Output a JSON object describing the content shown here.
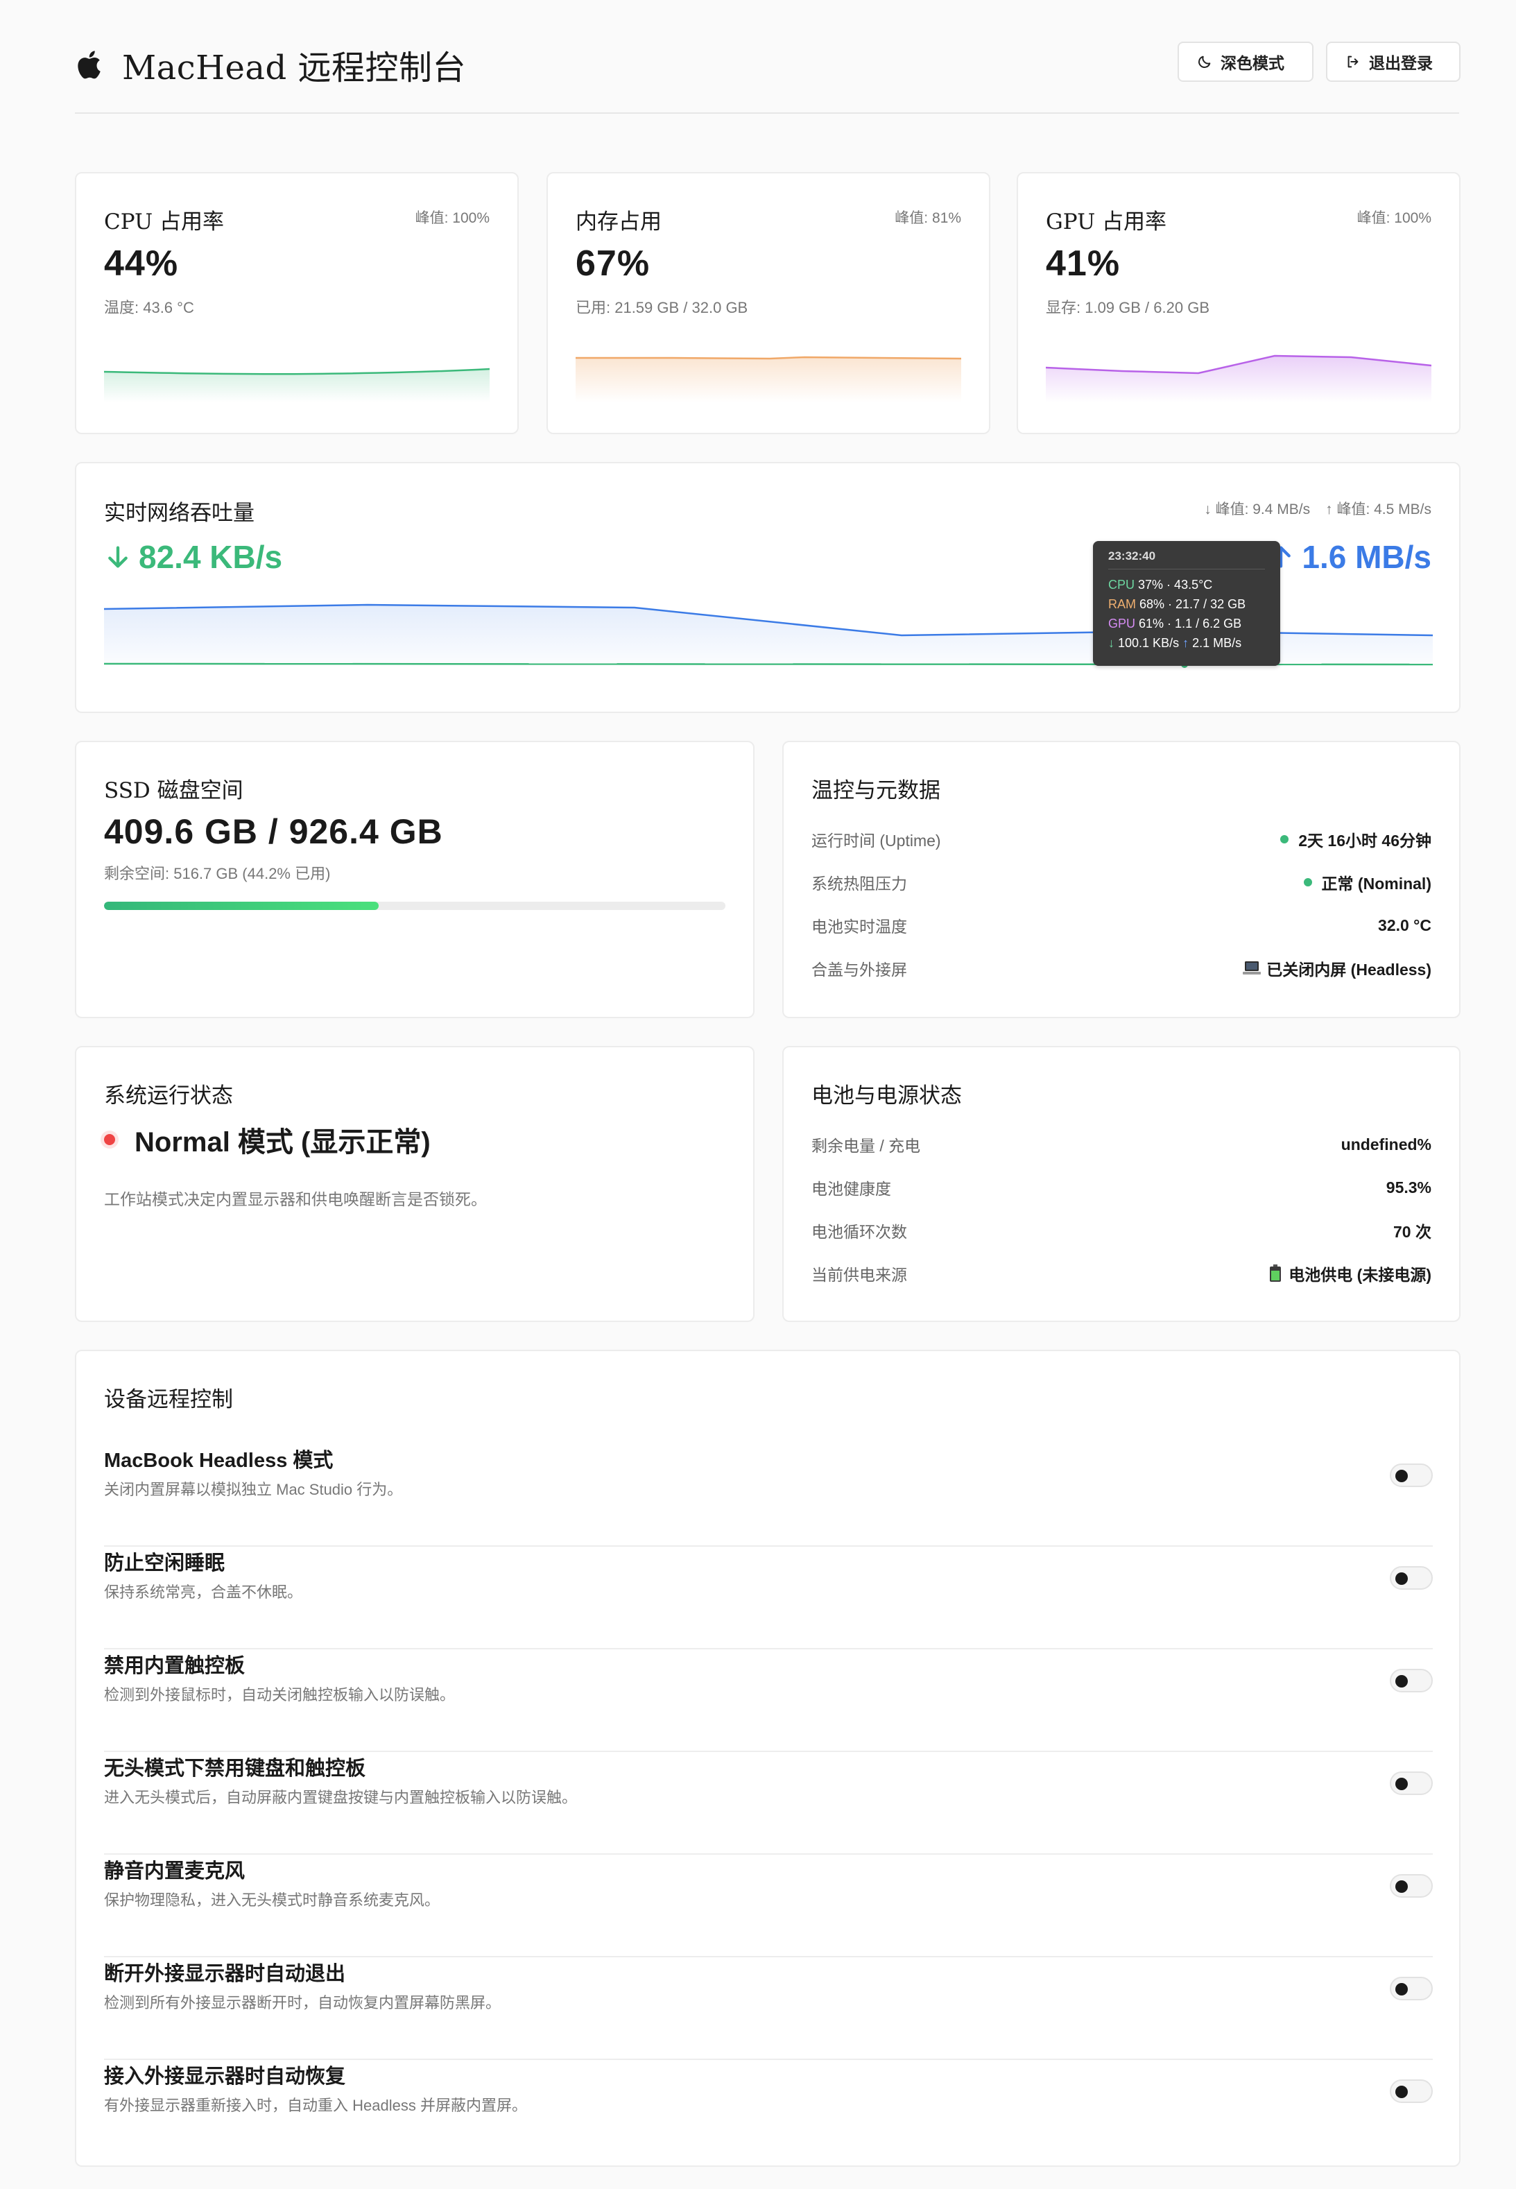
{
  "header": {
    "title": "MacHead 远程控制台",
    "dark_mode_label": "深色模式",
    "logout_label": "退出登录"
  },
  "metrics": {
    "cpu": {
      "title": "CPU 占用率",
      "peak": "峰值: 100%",
      "value": "44%",
      "sub": "温度: 43.6 °C",
      "color": "#3bb97a"
    },
    "mem": {
      "title": "内存占用",
      "peak": "峰值: 81%",
      "value": "67%",
      "sub": "已用: 21.59 GB / 32.0 GB",
      "color": "#f0a868"
    },
    "gpu": {
      "title": "GPU 占用率",
      "peak": "峰值: 100%",
      "value": "41%",
      "sub": "显存: 1.09 GB / 6.20 GB",
      "color": "#b862e8"
    }
  },
  "network": {
    "title": "实时网络吞吐量",
    "peak_down": "↓ 峰值: 9.4 MB/s",
    "peak_up": "↑ 峰值: 4.5 MB/s",
    "down": "82.4 KB/s",
    "up": "1.6 MB/s",
    "down_color": "#3bb97a",
    "up_color": "#3b7be6",
    "tooltip": {
      "time": "23:32:40",
      "cpu_key": "CPU",
      "cpu_val": "37% · 43.5°C",
      "ram_key": "RAM",
      "ram_val": "68% · 21.7 / 32 GB",
      "gpu_key": "GPU",
      "gpu_val": "61% · 1.1 / 6.2 GB",
      "down_val": "100.1 KB/s",
      "up_val": "2.1 MB/s"
    }
  },
  "ssd": {
    "title": "SSD 磁盘空间",
    "value": "409.6 GB / 926.4 GB",
    "sub": "剩余空间: 516.7 GB (44.2% 已用)",
    "used_fraction": 0.442
  },
  "thermal": {
    "title": "温控与元数据",
    "rows": [
      {
        "label": "运行时间 (Uptime)",
        "value": "2天 16小时 46分钟"
      },
      {
        "label": "系统热阻压力",
        "value": "正常 (Nominal)"
      },
      {
        "label": "电池实时温度",
        "value": "32.0 °C"
      },
      {
        "label": "合盖与外接屏",
        "value": "已关闭内屏 (Headless)"
      }
    ]
  },
  "status": {
    "title": "系统运行状态",
    "mode": "Normal 模式 (显示正常)",
    "desc": "工作站模式决定内置显示器和供电唤醒断言是否锁死。"
  },
  "battery": {
    "title": "电池与电源状态",
    "rows": [
      {
        "label": "剩余电量 / 充电",
        "value": "undefined%"
      },
      {
        "label": "电池健康度",
        "value": "95.3%"
      },
      {
        "label": "电池循环次数",
        "value": "70 次"
      },
      {
        "label": "当前供电来源",
        "value": "电池供电 (未接电源)"
      }
    ]
  },
  "controls": {
    "title": "设备远程控制",
    "items": [
      {
        "title": "MacBook Headless 模式",
        "desc": "关闭内置屏幕以模拟独立 Mac Studio 行为。",
        "enabled": false
      },
      {
        "title": "防止空闲睡眠",
        "desc": "保持系统常亮，合盖不休眠。",
        "enabled": false
      },
      {
        "title": "禁用内置触控板",
        "desc": "检测到外接鼠标时，自动关闭触控板输入以防误触。",
        "enabled": false
      },
      {
        "title": "无头模式下禁用键盘和触控板",
        "desc": "进入无头模式后，自动屏蔽内置键盘按键与内置触控板输入以防误触。",
        "enabled": false
      },
      {
        "title": "静音内置麦克风",
        "desc": "保护物理隐私，进入无头模式时静音系统麦克风。",
        "enabled": false
      },
      {
        "title": "断开外接显示器时自动退出",
        "desc": "检测到所有外接显示器断开时，自动恢复内置屏幕防黑屏。",
        "enabled": false
      },
      {
        "title": "接入外接显示器时自动恢复",
        "desc": "有外接显示器重新接入时，自动重入 Headless 并屏蔽内置屏。",
        "enabled": false
      }
    ]
  }
}
